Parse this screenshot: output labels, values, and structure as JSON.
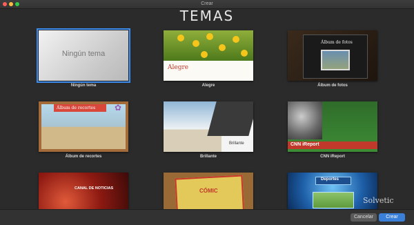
{
  "window": {
    "title": "Crear"
  },
  "heading": "TEMAS",
  "themes": [
    {
      "label": "Ningún tema",
      "thumb_text": "Ningún tema"
    },
    {
      "label": "Alegre",
      "thumb_text": "Alegre"
    },
    {
      "label": "Álbum de fotos",
      "thumb_text": "Álbum de fotos"
    },
    {
      "label": "Álbum de recortes",
      "thumb_text": "Álbum de recortes"
    },
    {
      "label": "Brillante",
      "thumb_text": "Brillante"
    },
    {
      "label": "CNN iReport",
      "thumb_text": "CNN iReport"
    },
    {
      "label": "",
      "thumb_text": "CANAL DE NOTICIAS"
    },
    {
      "label": "",
      "thumb_text": "CÓMIC"
    },
    {
      "label": "",
      "thumb_text": "Deportes"
    }
  ],
  "selected_theme": "Ningún tema",
  "watermark": "Solvetic",
  "footer": {
    "cancel_label": "Cancelar",
    "create_label": "Crear"
  },
  "colors": {
    "selection": "#3d8cf0",
    "primary_button": "#3a7fd8",
    "background": "#2b2b2b"
  }
}
